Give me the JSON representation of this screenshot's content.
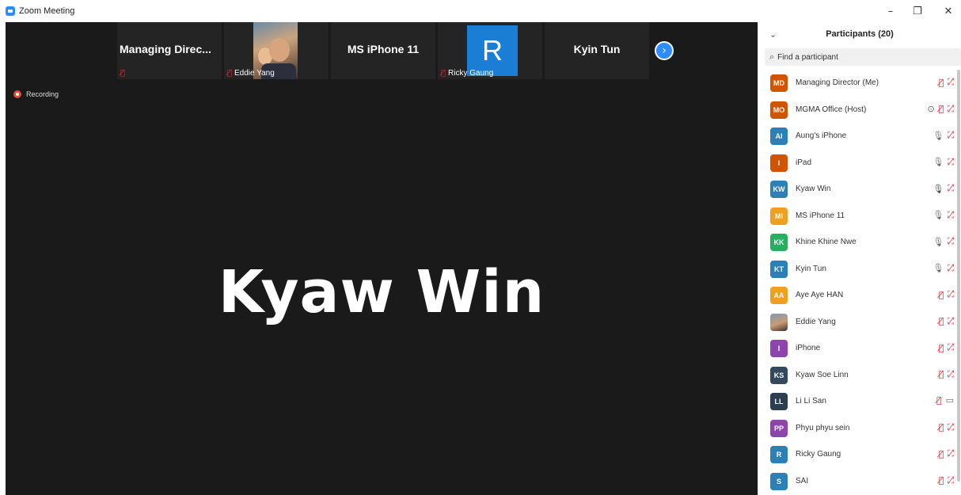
{
  "window": {
    "title": "Zoom Meeting",
    "minimize": "–",
    "maximize": "❐",
    "close": "✕"
  },
  "gallery": {
    "tiles": [
      {
        "name": "Managing Direc...",
        "label": ""
      },
      {
        "name": "",
        "label": "Eddie Yang"
      },
      {
        "name": "MS iPhone 11",
        "label": ""
      },
      {
        "name": "",
        "label": "Ricky Gaung",
        "avatar_letter": "R"
      },
      {
        "name": "Kyin Tun",
        "label": ""
      }
    ],
    "next_icon": "›"
  },
  "recording_label": "Recording",
  "active_speaker": "Kyaw Win",
  "panel": {
    "collapse_icon": "⌄",
    "title": "Participants (20)",
    "search_icon": "⌕",
    "search_placeholder": "Find a participant"
  },
  "participants": [
    {
      "initials": "MD",
      "name": "Managing Director (Me)",
      "color": "#d35400",
      "mic": "muted",
      "video": "off"
    },
    {
      "initials": "MO",
      "name": "MGMA Office (Host)",
      "color": "#d35400",
      "mic": "muted",
      "video": "off",
      "record": true
    },
    {
      "initials": "AI",
      "name": "Aung's iPhone",
      "color": "#2d7fb8",
      "mic": "on",
      "video": "off"
    },
    {
      "initials": "I",
      "name": "iPad",
      "color": "#d35400",
      "mic": "on",
      "video": "off"
    },
    {
      "initials": "KW",
      "name": "Kyaw Win",
      "color": "#2d7fb8",
      "mic": "speaking",
      "video": "off"
    },
    {
      "initials": "MI",
      "name": "MS iPhone 11",
      "color": "#f0a020",
      "mic": "on",
      "video": "off"
    },
    {
      "initials": "KK",
      "name": "Khine Khine Nwe",
      "color": "#27ae60",
      "mic": "on",
      "video": "off"
    },
    {
      "initials": "KT",
      "name": "Kyin Tun",
      "color": "#2d7fb8",
      "mic": "on",
      "video": "off"
    },
    {
      "initials": "AA",
      "name": "Aye Aye HAN",
      "color": "#f0a020",
      "mic": "muted",
      "video": "off"
    },
    {
      "initials": "",
      "name": "Eddie Yang",
      "color": "photo",
      "mic": "muted",
      "video": "off"
    },
    {
      "initials": "I",
      "name": "iPhone",
      "color": "#8e44ad",
      "mic": "muted",
      "video": "off"
    },
    {
      "initials": "KS",
      "name": "Kyaw Soe Linn",
      "color": "#34495e",
      "mic": "muted",
      "video": "off"
    },
    {
      "initials": "LL",
      "name": "Li Li San",
      "color": "#2c3e50",
      "mic": "muted",
      "video": "on"
    },
    {
      "initials": "PP",
      "name": "Phyu phyu sein",
      "color": "#8e44ad",
      "mic": "muted",
      "video": "off"
    },
    {
      "initials": "R",
      "name": "Ricky Gaung",
      "color": "#2d7fb8",
      "mic": "muted",
      "video": "off"
    },
    {
      "initials": "S",
      "name": "SAI",
      "color": "#2d7fb8",
      "mic": "muted",
      "video": "off"
    }
  ],
  "icons": {
    "mic_muted": "mic-muted-icon",
    "mic_on": "mic-icon",
    "video_off": "video-off-icon",
    "video_on": "video-icon",
    "record": "record-icon"
  }
}
